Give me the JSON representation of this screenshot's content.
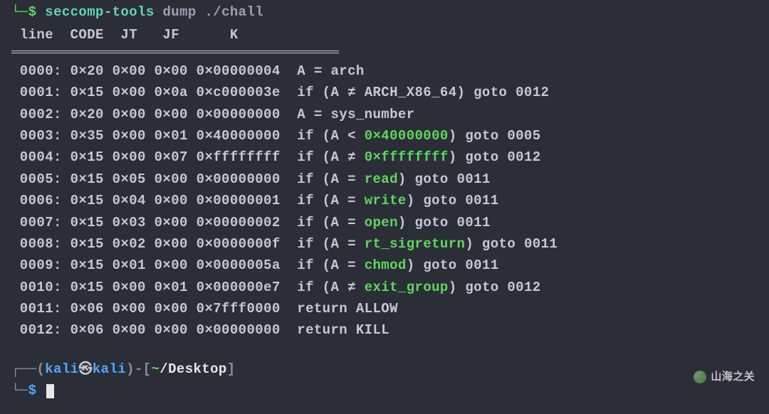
{
  "command": {
    "arrow": "└─$ ",
    "tool": "seccomp-tools",
    "args": "dump ./chall"
  },
  "header": {
    "cols": " line  CODE  JT   JF      K"
  },
  "rows": [
    {
      "line": "0000",
      "code": "0×20",
      "jt": "0×00",
      "jf": "0×00",
      "k": "0×00000004",
      "desc": "A = arch",
      "type": "plain"
    },
    {
      "line": "0001",
      "code": "0×15",
      "jt": "0×00",
      "jf": "0×0a",
      "k": "0×c000003e",
      "desc_pre": "if (A ",
      "op": "≠",
      "desc_mid": " ARCH_X86_64) goto 0012",
      "type": "cmp_plain"
    },
    {
      "line": "0002",
      "code": "0×20",
      "jt": "0×00",
      "jf": "0×00",
      "k": "0×00000000",
      "desc": "A = sys_number",
      "type": "plain"
    },
    {
      "line": "0003",
      "code": "0×35",
      "jt": "0×00",
      "jf": "0×01",
      "k": "0×40000000",
      "desc_pre": "if (A < ",
      "hex": "0×40000000",
      "desc_mid": ") goto 0005",
      "type": "cmp_hex"
    },
    {
      "line": "0004",
      "code": "0×15",
      "jt": "0×00",
      "jf": "0×07",
      "k": "0×ffffffff",
      "desc_pre": "if (A ",
      "op": "≠",
      "hex": "0×ffffffff",
      "desc_mid": ") goto 0012",
      "type": "cmp_op_hex"
    },
    {
      "line": "0005",
      "code": "0×15",
      "jt": "0×05",
      "jf": "0×00",
      "k": "0×00000000",
      "desc_pre": "if (A ",
      "op": "=",
      "sym": "read",
      "desc_mid": ") goto 0011",
      "type": "cmp_sym"
    },
    {
      "line": "0006",
      "code": "0×15",
      "jt": "0×04",
      "jf": "0×00",
      "k": "0×00000001",
      "desc_pre": "if (A ",
      "op": "=",
      "sym": "write",
      "desc_mid": ") goto 0011",
      "type": "cmp_sym"
    },
    {
      "line": "0007",
      "code": "0×15",
      "jt": "0×03",
      "jf": "0×00",
      "k": "0×00000002",
      "desc_pre": "if (A ",
      "op": "=",
      "sym": "open",
      "desc_mid": ") goto 0011",
      "type": "cmp_sym"
    },
    {
      "line": "0008",
      "code": "0×15",
      "jt": "0×02",
      "jf": "0×00",
      "k": "0×0000000f",
      "desc_pre": "if (A ",
      "op": "=",
      "sym": "rt_sigreturn",
      "desc_mid": ") goto 0011",
      "type": "cmp_sym"
    },
    {
      "line": "0009",
      "code": "0×15",
      "jt": "0×01",
      "jf": "0×00",
      "k": "0×0000005a",
      "desc_pre": "if (A ",
      "op": "=",
      "sym": "chmod",
      "desc_mid": ") goto 0011",
      "type": "cmp_sym"
    },
    {
      "line": "0010",
      "code": "0×15",
      "jt": "0×00",
      "jf": "0×01",
      "k": "0×000000e7",
      "desc_pre": "if (A ",
      "op": "≠",
      "sym": "exit_group",
      "desc_mid": ") goto 0012",
      "type": "cmp_sym"
    },
    {
      "line": "0011",
      "code": "0×06",
      "jt": "0×00",
      "jf": "0×00",
      "k": "0×7fff0000",
      "desc": "return ALLOW",
      "type": "plain"
    },
    {
      "line": "0012",
      "code": "0×06",
      "jt": "0×00",
      "jf": "0×00",
      "k": "0×00000000",
      "desc": "return KILL",
      "type": "plain"
    }
  ],
  "prompt2": {
    "corner_top": "┌──(",
    "user": "kali",
    "skull": "㉿",
    "host": "kali",
    "close_paren": ")",
    "dash": "-[",
    "tilde": "~",
    "path": "/Desktop",
    "close_br": "]",
    "corner_btm": "└─",
    "dollar": "$"
  },
  "watermark": "山海之关"
}
